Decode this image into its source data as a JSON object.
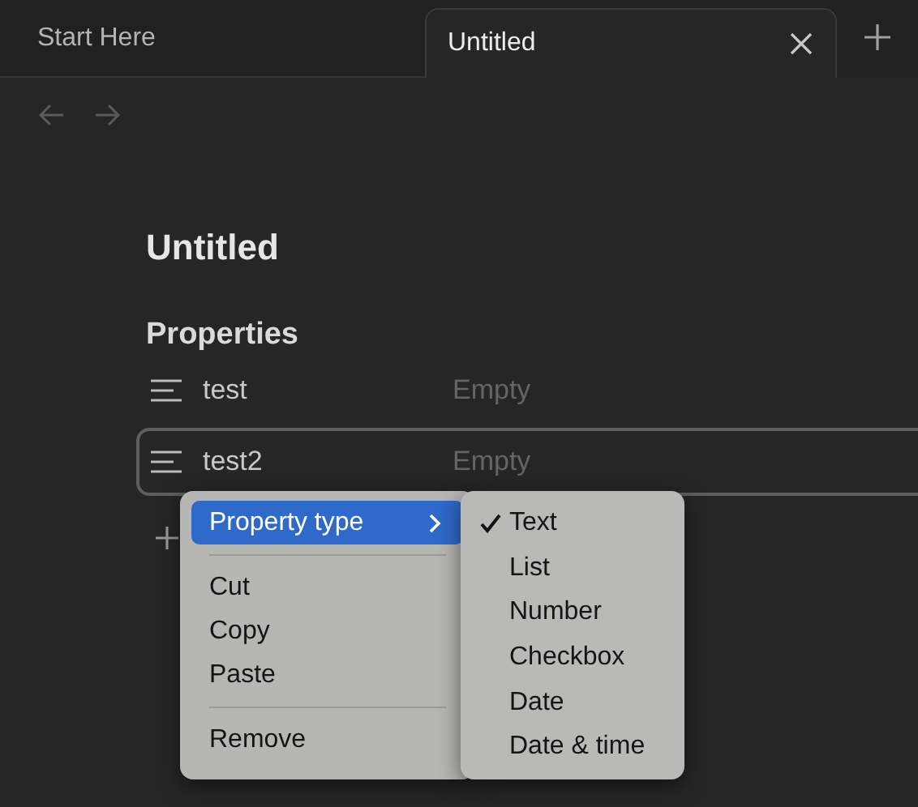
{
  "tabs": [
    {
      "label": "Start Here",
      "selected": false
    },
    {
      "label": "Untitled",
      "selected": true
    }
  ],
  "title": "Untitled",
  "properties_heading": "Properties",
  "properties": [
    {
      "name": "test",
      "placeholder": "Empty",
      "focused": false
    },
    {
      "name": "test2",
      "placeholder": "Empty",
      "focused": true
    }
  ],
  "context_menu": {
    "groups": [
      [
        {
          "label": "Property type",
          "kind": "submenu",
          "highlighted": true
        }
      ],
      [
        {
          "label": "Cut",
          "kind": "action",
          "highlighted": false
        },
        {
          "label": "Copy",
          "kind": "action",
          "highlighted": false
        },
        {
          "label": "Paste",
          "kind": "action",
          "highlighted": false
        }
      ],
      [
        {
          "label": "Remove",
          "kind": "action",
          "highlighted": false
        }
      ]
    ]
  },
  "submenu": {
    "items": [
      {
        "label": "Text",
        "selected": true
      },
      {
        "label": "List",
        "selected": false
      },
      {
        "label": "Number",
        "selected": false
      },
      {
        "label": "Checkbox",
        "selected": false
      },
      {
        "label": "Date",
        "selected": false
      },
      {
        "label": "Date & time",
        "selected": false
      }
    ]
  }
}
